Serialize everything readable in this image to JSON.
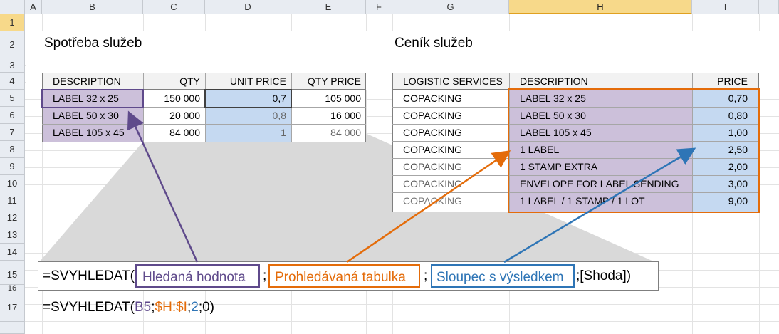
{
  "columns": [
    "A",
    "B",
    "C",
    "D",
    "E",
    "F",
    "G",
    "H",
    "I"
  ],
  "rows": [
    "1",
    "2",
    "3",
    "4",
    "5",
    "6",
    "7",
    "8",
    "9",
    "10",
    "11",
    "12",
    "13",
    "14",
    "15",
    "16",
    "17"
  ],
  "titles": {
    "left": "Spotřeba služeb",
    "right": "Ceník služeb"
  },
  "left_table": {
    "headers": [
      "DESCRIPTION",
      "QTY",
      "UNIT PRICE",
      "QTY PRICE"
    ],
    "rows": [
      [
        "LABEL   32 x 25",
        "150 000",
        "0,7",
        "105 000"
      ],
      [
        "LABEL   50 x 30",
        "20 000",
        "0,8",
        "16 000"
      ],
      [
        "LABEL 105 x 45",
        "84 000",
        "1",
        "84 000"
      ]
    ]
  },
  "right_table": {
    "headers": [
      "LOGISTIC SERVICES",
      "DESCRIPTION",
      "PRICE"
    ],
    "rows": [
      [
        "COPACKING",
        "LABEL   32 x 25",
        "0,70"
      ],
      [
        "COPACKING",
        "LABEL   50 x 30",
        "0,80"
      ],
      [
        "COPACKING",
        "LABEL 105 x 45",
        "1,00"
      ],
      [
        "COPACKING",
        "1 LABEL",
        "2,50"
      ],
      [
        "COPACKING",
        "1 STAMP EXTRA",
        "2,00"
      ],
      [
        "COPACKING",
        "ENVELOPE FOR LABEL SENDING",
        "3,00"
      ],
      [
        "COPACKING",
        "1 LABEL / 1 STAMP / 1 LOT",
        "9,00"
      ]
    ]
  },
  "syntax": {
    "prefix": "=SVYHLEDAT(",
    "arg1": "Hledaná hodnota",
    "sep1": ";",
    "arg2": "Prohledávaná tabulka",
    "sep2": ";",
    "arg3": "Sloupec s výsledkem",
    "suffix": ";[Shoda])"
  },
  "formula": {
    "prefix": "=SVYHLEDAT(",
    "arg1": "B5",
    "sep1": ";",
    "arg2": "$H:$I",
    "sep2": ";",
    "arg3": "2",
    "suffix": ";0)"
  },
  "colors": {
    "purple": "#5f4a8b",
    "orange": "#e46c0a",
    "blue": "#2e75b6",
    "purple_fill": "#ccc0da",
    "blue_fill": "#c5d9f1"
  }
}
